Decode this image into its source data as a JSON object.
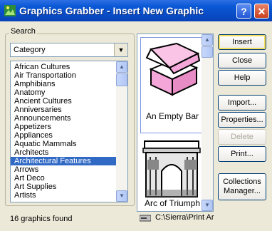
{
  "window": {
    "title": "Graphics Grabber - Insert New Graphic",
    "help_glyph": "?",
    "close_glyph": "✕"
  },
  "search": {
    "group_label": "Search",
    "combo_value": "Category",
    "categories": [
      "African Cultures",
      "Air Transportation",
      "Amphibians",
      "Anatomy",
      "Ancient Cultures",
      "Anniversaries",
      "Announcements",
      "Appetizers",
      "Appliances",
      "Aquatic Mammals",
      "Architects",
      "Architectural Features",
      "Arrows",
      "Art Deco",
      "Art Supplies",
      "Artists"
    ],
    "selected_category": "Architectural Features"
  },
  "status": {
    "found_text": "16 graphics found"
  },
  "gallery": {
    "items": [
      {
        "caption": "An Empty Bar"
      },
      {
        "caption": "Arc of Triumph"
      }
    ]
  },
  "path": {
    "text": "C:\\Sierra\\Print Ar"
  },
  "buttons": {
    "insert": "Insert",
    "close": "Close",
    "help": "Help",
    "import": "Import...",
    "properties": "Properties...",
    "delete": "Delete",
    "print": "Print...",
    "collections_line1": "Collections",
    "collections_line2": "Manager..."
  },
  "colors": {
    "titlebar": "#0A58D6",
    "selection": "#316AC5",
    "window_bg": "#ECE9D8",
    "box_pink": "#F4A6D8"
  }
}
